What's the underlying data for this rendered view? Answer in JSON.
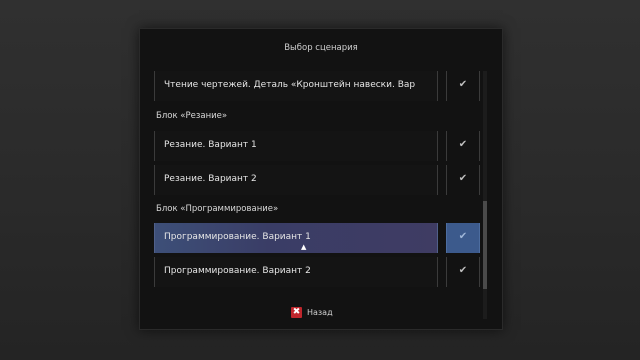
{
  "dialog": {
    "title": "Выбор сценария"
  },
  "list": {
    "items": [
      {
        "type": "item",
        "label": "Чтение чертежей. Деталь «Кронштейн навески. Вар",
        "checked": true,
        "active": false
      },
      {
        "type": "heading",
        "label": "Блок «Резание»"
      },
      {
        "type": "item",
        "label": "Резание. Вариант 1",
        "checked": true,
        "active": false
      },
      {
        "type": "item",
        "label": "Резание. Вариант 2",
        "checked": true,
        "active": false
      },
      {
        "type": "heading",
        "label": "Блок «Программирование»"
      },
      {
        "type": "item",
        "label": "Программирование. Вариант 1",
        "checked": true,
        "active": true
      },
      {
        "type": "item",
        "label": "Программирование. Вариант 2",
        "checked": true,
        "active": false
      }
    ],
    "check_glyph": "✔"
  },
  "footer": {
    "back_label": "Назад",
    "back_icon": "close-icon",
    "back_icon_glyph": "✖"
  },
  "colors": {
    "highlight": "#3d4f78",
    "back_icon": "#c0262c"
  }
}
